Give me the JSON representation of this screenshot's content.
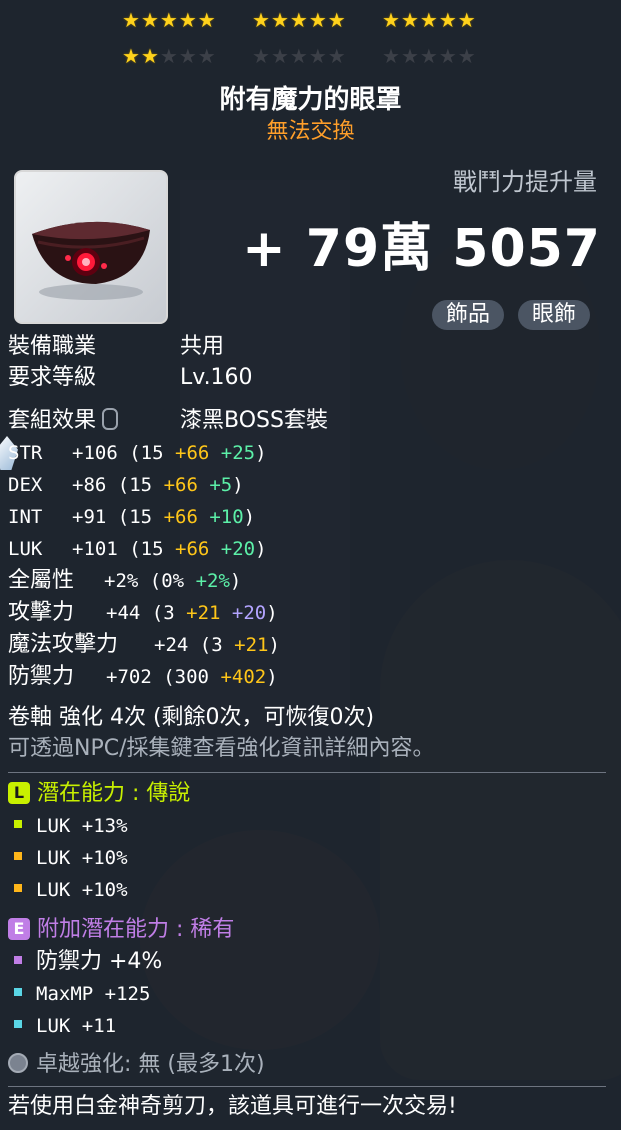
{
  "stars": {
    "row1": [
      "on",
      "on",
      "on",
      "on",
      "on"
    ],
    "row2": [
      "on",
      "on",
      "on",
      "on",
      "on"
    ],
    "row3": [
      "on",
      "on",
      "on",
      "on",
      "on"
    ],
    "row4": [
      "on",
      "on",
      "off",
      "off",
      "off"
    ],
    "row5": [
      "off",
      "off",
      "off",
      "off",
      "off"
    ],
    "row6": [
      "off",
      "off",
      "off",
      "off",
      "off"
    ]
  },
  "item": {
    "name": "附有魔力的眼罩",
    "trade_status": "無法交換",
    "combat_power_label": "戰鬥力提升量",
    "combat_power_value": "+ 79萬 5057",
    "tags": [
      "飾品",
      "眼飾"
    ]
  },
  "requirements": {
    "job_label": "裝備職業",
    "job_value": "共用",
    "level_label": "要求等級",
    "level_value": "Lv.160"
  },
  "set": {
    "label": "套組效果",
    "value": "漆黑BOSS套裝"
  },
  "stats": {
    "str": {
      "name": "STR",
      "total": "+106",
      "base": "15",
      "star": "+66",
      "bonus": "+25"
    },
    "dex": {
      "name": "DEX",
      "total": "+86",
      "base": "15",
      "star": "+66",
      "bonus": "+5"
    },
    "int": {
      "name": "INT",
      "total": "+91",
      "base": "15",
      "star": "+66",
      "bonus": "+10"
    },
    "luk": {
      "name": "LUK",
      "total": "+101",
      "base": "15",
      "star": "+66",
      "bonus": "+20"
    },
    "all": {
      "name": "全屬性",
      "total": "+2%",
      "base": "0%",
      "bonus": "+2%"
    },
    "att": {
      "name": "攻擊力",
      "total": "+44",
      "base": "3",
      "star": "+21",
      "bonus": "+20"
    },
    "matt": {
      "name": "魔法攻擊力",
      "total": "+24",
      "base": "3",
      "star": "+21"
    },
    "def": {
      "name": "防禦力",
      "total": "+702",
      "base": "300",
      "star": "+402"
    }
  },
  "scroll": {
    "line": "卷軸 強化 4次 (剩餘0次，可恢復0次)",
    "note": "可透過NPC/採集鍵查看強化資訊詳細內容。"
  },
  "potential": {
    "badge": "L",
    "label": "潛在能力",
    "grade": "傳說",
    "lines": [
      "LUK +13%",
      "LUK +10%",
      "LUK +10%"
    ]
  },
  "bonus_potential": {
    "badge": "E",
    "label": "附加潛在能力",
    "grade": "稀有",
    "lines": [
      "防禦力 +4%",
      "MaxMP +125",
      "LUK +11"
    ]
  },
  "exceptional": {
    "line": "卓越強化:  無 (最多1次)"
  },
  "footer": "若使用白金神奇剪刀，該道具可進行一次交易!",
  "colors": {
    "title": "#ffffff",
    "untradable": "#ff9f2a",
    "star_bonus": "#ffc619",
    "flame_bonus": "#5cf0a8",
    "legendary": "#c8f000",
    "rare": "#c07ee6"
  }
}
